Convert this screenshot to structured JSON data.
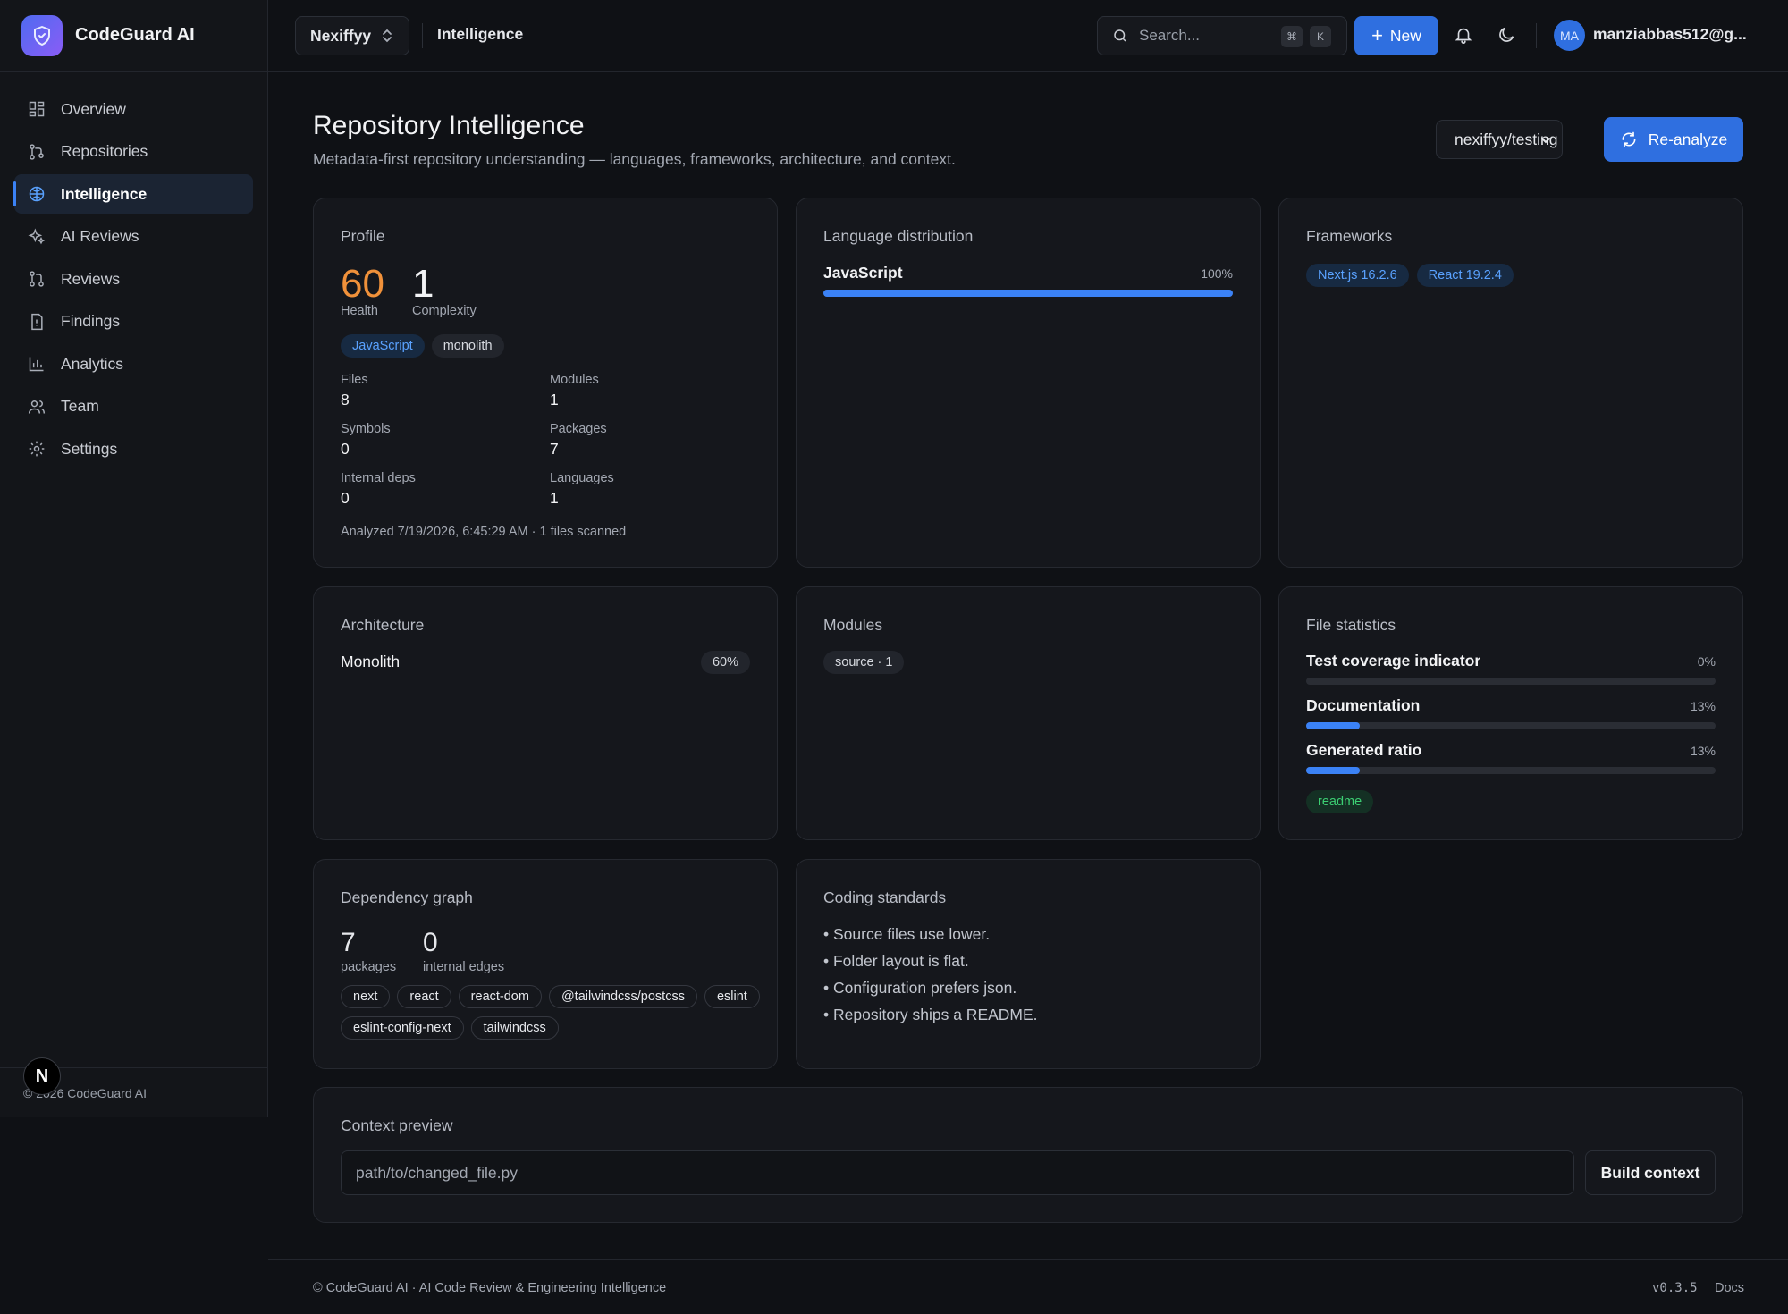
{
  "brand": {
    "name": "CodeGuard AI"
  },
  "sidebar": {
    "items": [
      {
        "label": "Overview",
        "icon": "grid-icon"
      },
      {
        "label": "Repositories",
        "icon": "git-branch-icon"
      },
      {
        "label": "Intelligence",
        "icon": "brain-icon",
        "active": true
      },
      {
        "label": "AI Reviews",
        "icon": "sparkles-icon"
      },
      {
        "label": "Reviews",
        "icon": "git-pull-request-icon"
      },
      {
        "label": "Findings",
        "icon": "alert-file-icon"
      },
      {
        "label": "Analytics",
        "icon": "bar-chart-icon"
      },
      {
        "label": "Team",
        "icon": "users-icon"
      },
      {
        "label": "Settings",
        "icon": "gear-icon"
      }
    ],
    "footer": "© 2026 CodeGuard AI",
    "badge": "N"
  },
  "topbar": {
    "org": "Nexiffyy",
    "breadcrumb": "Intelligence",
    "search_placeholder": "Search...",
    "kbd_cmd": "⌘",
    "kbd_k": "K",
    "new_label": "New",
    "avatar_initials": "MA",
    "user_email": "manziabbas512@g..."
  },
  "header": {
    "title": "Repository Intelligence",
    "subtitle": "Metadata-first repository understanding — languages, frameworks, architecture, and context.",
    "repo_select": "nexiffyy/testing",
    "reanalyze_label": "Re-analyze"
  },
  "profile": {
    "title": "Profile",
    "health_value": "60",
    "health_label": "Health",
    "complexity_value": "1",
    "complexity_label": "Complexity",
    "tags": [
      "JavaScript",
      "monolith"
    ],
    "stats": [
      {
        "label": "Files",
        "value": "8"
      },
      {
        "label": "Modules",
        "value": "1"
      },
      {
        "label": "Symbols",
        "value": "0"
      },
      {
        "label": "Packages",
        "value": "7"
      },
      {
        "label": "Internal deps",
        "value": "0"
      },
      {
        "label": "Languages",
        "value": "1"
      }
    ],
    "analyzed": "Analyzed 7/19/2026, 6:45:29 AM · 1 files scanned"
  },
  "languages": {
    "title": "Language distribution",
    "items": [
      {
        "name": "JavaScript",
        "percent_label": "100%",
        "percent": 100
      }
    ]
  },
  "frameworks": {
    "title": "Frameworks",
    "items": [
      "Next.js 16.2.6",
      "React 19.2.4"
    ]
  },
  "architecture": {
    "title": "Architecture",
    "name": "Monolith",
    "confidence": "60%"
  },
  "modules": {
    "title": "Modules",
    "items": [
      "source · 1"
    ]
  },
  "file_stats": {
    "title": "File statistics",
    "rows": [
      {
        "label": "Test coverage indicator",
        "pct_label": "0%",
        "percent": 0
      },
      {
        "label": "Documentation",
        "pct_label": "13%",
        "percent": 13
      },
      {
        "label": "Generated ratio",
        "pct_label": "13%",
        "percent": 13
      }
    ],
    "tag": "readme"
  },
  "dep_graph": {
    "title": "Dependency graph",
    "packages_value": "7",
    "packages_label": "packages",
    "edges_value": "0",
    "edges_label": "internal edges",
    "packages": [
      "next",
      "react",
      "react-dom",
      "@tailwindcss/postcss",
      "eslint",
      "eslint-config-next",
      "tailwindcss"
    ]
  },
  "coding_standards": {
    "title": "Coding standards",
    "items": [
      "• Source files use lower.",
      "• Folder layout is flat.",
      "• Configuration prefers json.",
      "• Repository ships a README."
    ]
  },
  "context": {
    "title": "Context preview",
    "input_placeholder": "path/to/changed_file.py",
    "button_label": "Build context"
  },
  "footer": {
    "left": "© CodeGuard AI · AI Code Review & Engineering Intelligence",
    "version": "v0.3.5",
    "docs": "Docs"
  },
  "colors": {
    "accent": "#2f6fe0",
    "health": "#f0913a",
    "bar": "#3b82f6",
    "background": "#0f1115",
    "card": "#15171c"
  }
}
